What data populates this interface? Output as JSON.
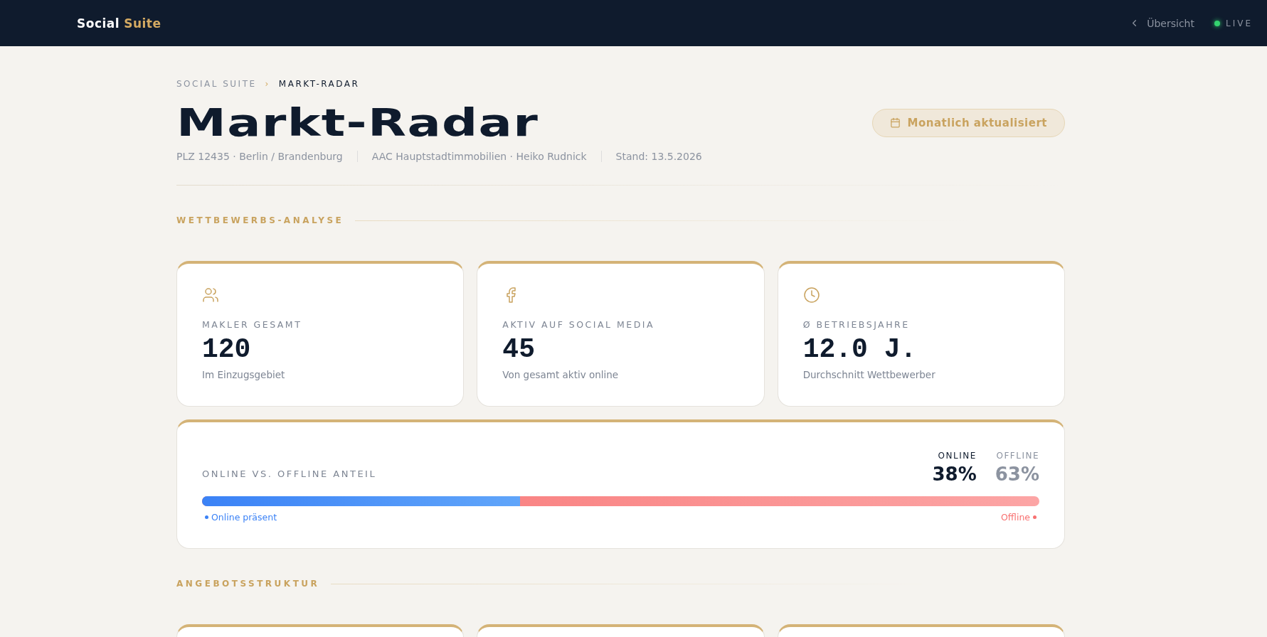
{
  "topbar": {
    "brand": {
      "first": "Social",
      "second": "Suite"
    },
    "back_link": "Übersicht",
    "live": {
      "label": "LIVE",
      "on": true
    }
  },
  "breadcrumb": [
    {
      "label": "SOCIAL SUITE",
      "selected": false
    },
    {
      "separator": "›"
    },
    {
      "label": "MARKT-RADAR",
      "selected": true
    }
  ],
  "title": "Markt-Radar",
  "update_badge": "Monatlich aktualisiert",
  "meta": [
    "PLZ 12435 · Berlin / Brandenburg",
    "AAC Hauptstadtimmobilien · Heiko Rudnick",
    "Stand: 13.5.2026"
  ],
  "sections": [
    {
      "title": "WETTBEWERBS-ANALYSE",
      "stats": [
        {
          "kind": "users",
          "label": "MAKLER GESAMT",
          "value": "120",
          "note": "Im Einzugsgebiet"
        },
        {
          "kind": "facebook",
          "label": "AKTIV AUF SOCIAL MEDIA",
          "value": "45",
          "note": "Von gesamt aktiv online"
        },
        {
          "kind": "clock",
          "label": "Ø BETRIEBSJAHRE",
          "value": "12.0 J.",
          "note": "Durchschnitt Wettbewerber"
        }
      ],
      "share": {
        "title": "ONLINE VS. OFFLINE ANTEIL",
        "online_label": "ONLINE",
        "online_value": "38%",
        "offline_label": "OFFLINE",
        "offline_value": "63%",
        "level": 0.38,
        "online_legend": "Online präsent",
        "offline_legend": "Offline"
      }
    },
    {
      "title": "ANGEBOTSSTRUKTUR"
    }
  ]
}
